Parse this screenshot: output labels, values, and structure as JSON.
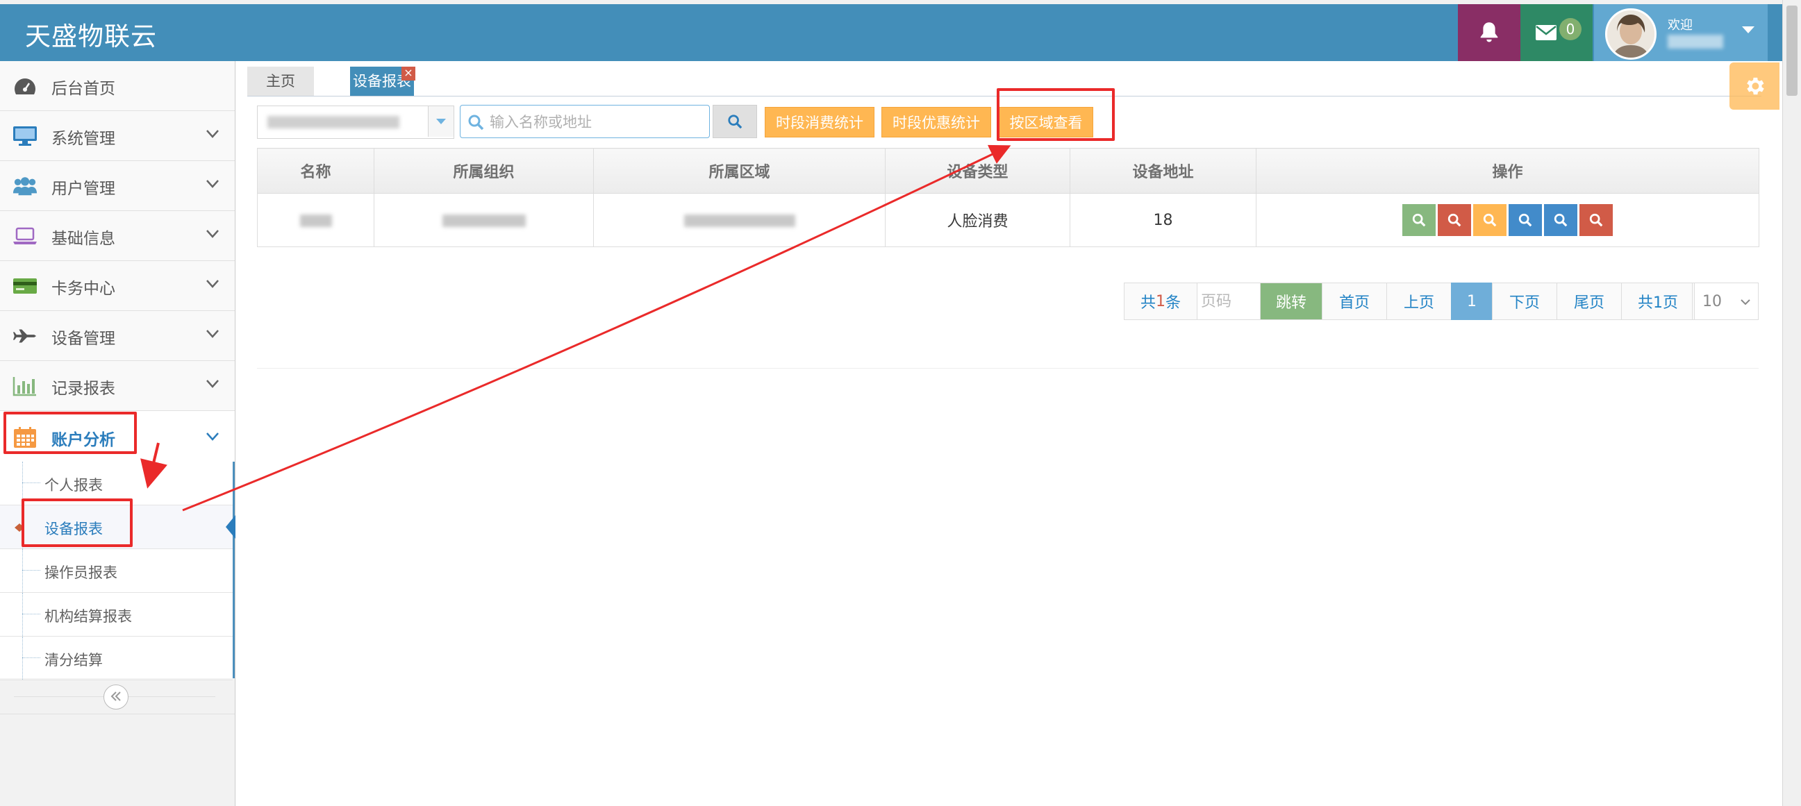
{
  "app": {
    "brand": "天盛物联云"
  },
  "header": {
    "messages_count": "0",
    "welcome": "欢迎",
    "colors": {
      "bar": "#438eb9",
      "bell": "#892e65",
      "mail": "#2e8965",
      "user": "#62a8d1"
    }
  },
  "sidebar": {
    "items": [
      {
        "label": "后台首页",
        "icon": "dashboard-icon"
      },
      {
        "label": "系统管理",
        "icon": "monitor-icon"
      },
      {
        "label": "用户管理",
        "icon": "users-icon"
      },
      {
        "label": "基础信息",
        "icon": "laptop-icon"
      },
      {
        "label": "卡务中心",
        "icon": "credit-card-icon"
      },
      {
        "label": "设备管理",
        "icon": "plane-icon"
      },
      {
        "label": "记录报表",
        "icon": "bar-chart-icon"
      },
      {
        "label": "账户分析",
        "icon": "calendar-icon"
      }
    ],
    "submenu": [
      {
        "label": "个人报表"
      },
      {
        "label": "设备报表"
      },
      {
        "label": "操作员报表"
      },
      {
        "label": "机构结算报表"
      },
      {
        "label": "清分结算"
      }
    ]
  },
  "tabs": {
    "home": "主页",
    "current": "设备报表",
    "close": "×"
  },
  "toolbar": {
    "search_placeholder": "输入名称或地址",
    "btn_period_consume": "时段消费统计",
    "btn_period_discount": "时段优惠统计",
    "btn_by_region": "按区域查看"
  },
  "table": {
    "headers": [
      "名称",
      "所属组织",
      "所属区域",
      "设备类型",
      "设备地址",
      "操作"
    ],
    "rows": [
      {
        "device_type": "人脸消费",
        "address": "18"
      }
    ]
  },
  "pagination": {
    "total_prefix": "共",
    "total_count": "1",
    "total_suffix": "条",
    "page_input_placeholder": "页码",
    "jump": "跳转",
    "first": "首页",
    "prev": "上页",
    "current": "1",
    "next": "下页",
    "last": "尾页",
    "pages": "共1页",
    "page_size": "10"
  }
}
